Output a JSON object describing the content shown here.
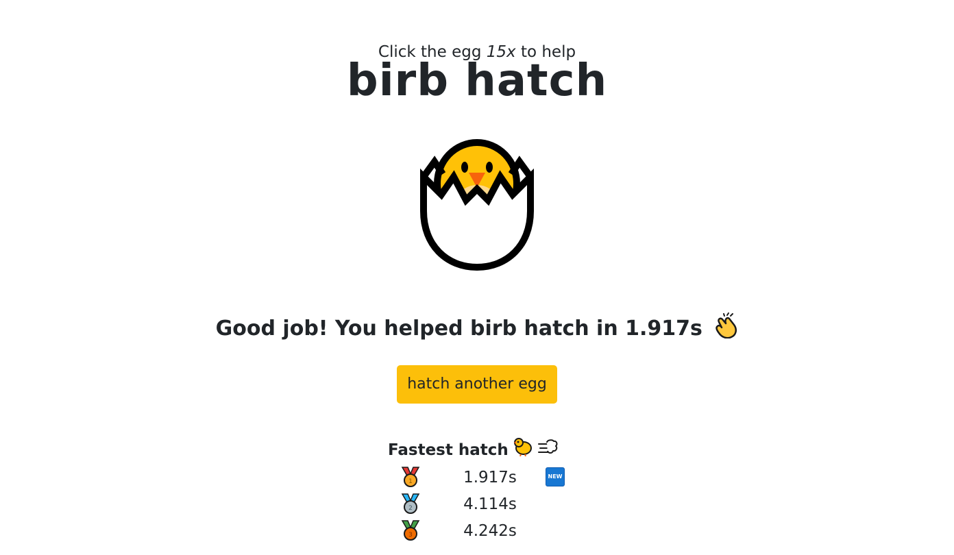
{
  "header": {
    "subtitle_prefix": "Click the egg",
    "subtitle_count": "15x",
    "subtitle_suffix": "to help",
    "title": "birb hatch"
  },
  "egg": {
    "icon": "hatching-chick-icon"
  },
  "result": {
    "message": "Good job! You helped birb hatch in 1.917s",
    "emoji": "clapping-hands-icon"
  },
  "action": {
    "button_label": "hatch another egg"
  },
  "leaderboard": {
    "title": "Fastest hatch",
    "title_icons": [
      "front-facing-chick-icon",
      "dash-icon"
    ],
    "entries": [
      {
        "medal": "gold-medal-icon",
        "time": "1.917s",
        "badge": "NEW"
      },
      {
        "medal": "silver-medal-icon",
        "time": "4.114s"
      },
      {
        "medal": "bronze-medal-icon",
        "time": "4.242s"
      }
    ]
  },
  "colors": {
    "button": "#fcbf0a",
    "text": "#212529",
    "chick": "#ffc107",
    "beak": "#f7630c"
  }
}
